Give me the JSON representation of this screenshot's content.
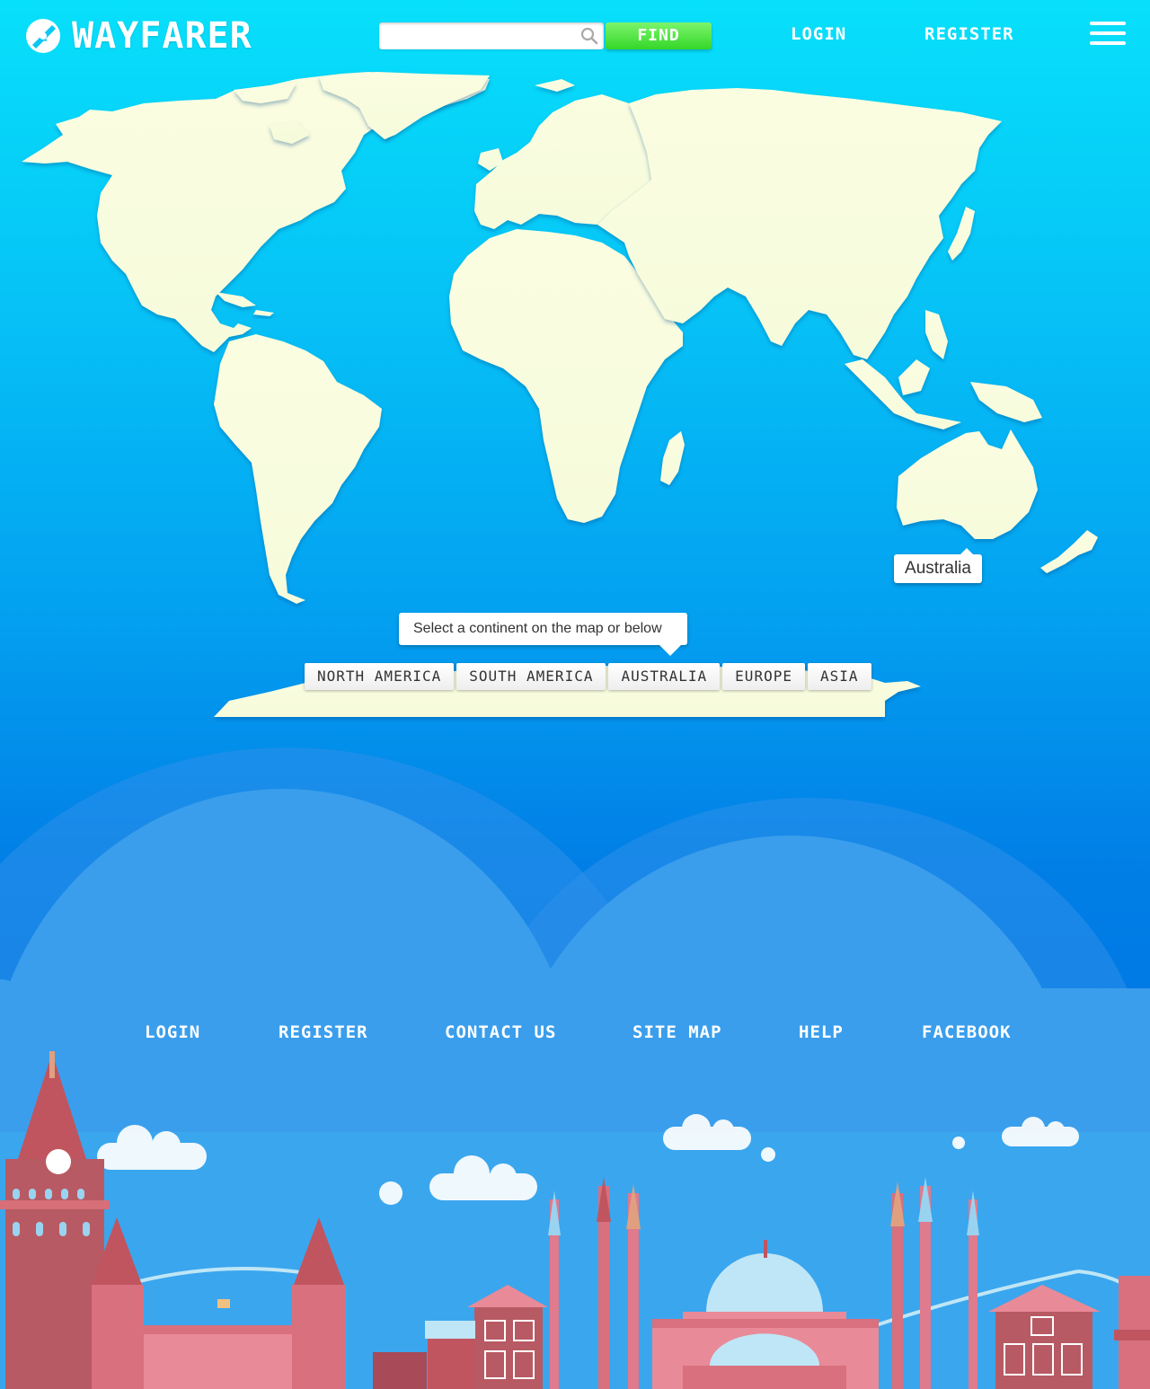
{
  "brand": {
    "name": "WAYFARER",
    "logo_icon": "compass-icon"
  },
  "search": {
    "value": "",
    "placeholder": "",
    "icon": "search-icon",
    "button_label": "FIND"
  },
  "nav": {
    "login": "LOGIN",
    "register": "REGISTER",
    "menu_icon": "hamburger-menu-icon"
  },
  "map": {
    "hover_tooltip": "Australia",
    "hint": "Select a continent on the map or below",
    "continents": [
      "NORTH AMERICA",
      "SOUTH AMERICA",
      "AUSTRALIA",
      "EUROPE",
      "ASIA"
    ]
  },
  "footer": {
    "links": [
      "LOGIN",
      "REGISTER",
      "CONTACT US",
      "SITE MAP",
      "HELP",
      "FACEBOOK"
    ]
  },
  "colors": {
    "land": "#fbfde0",
    "find_button": "#35d629",
    "sky_top": "#07e0fb",
    "sky_bottom": "#0077e4",
    "tower": "#c0555f",
    "mosque": "#e07a8d"
  }
}
